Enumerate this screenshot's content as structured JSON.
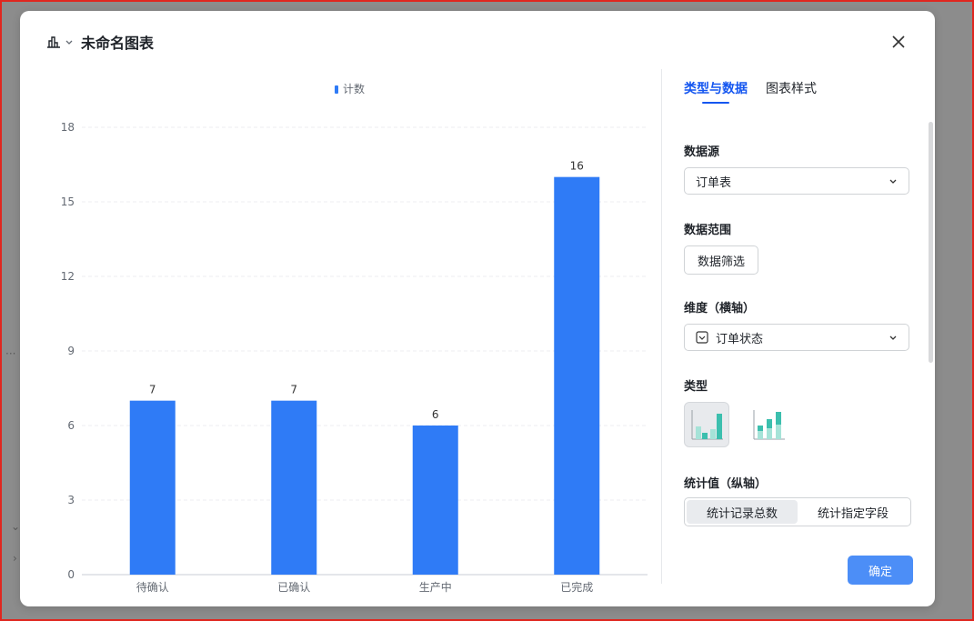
{
  "header": {
    "title": "未命名图表",
    "chart_type_icon": "bar-chart-icon",
    "close_icon": "close-icon"
  },
  "chart_data": {
    "type": "bar",
    "categories": [
      "待确认",
      "已确认",
      "生产中",
      "已完成"
    ],
    "series": [
      {
        "name": "计数",
        "values": [
          7,
          7,
          6,
          16
        ]
      }
    ],
    "ylim": [
      0,
      18
    ],
    "yticks": [
      0,
      3,
      6,
      9,
      12,
      15,
      18
    ],
    "grid": true,
    "legend": "top-center",
    "color": "#2f7bf6"
  },
  "panel": {
    "tabs": [
      {
        "label": "类型与数据",
        "active": true
      },
      {
        "label": "图表样式",
        "active": false
      }
    ],
    "datasource": {
      "label": "数据源",
      "value": "订单表"
    },
    "range": {
      "label": "数据范围",
      "button": "数据筛选"
    },
    "dimension": {
      "label": "维度（横轴）",
      "value": "订单状态",
      "icon": "single-select-field-icon"
    },
    "type": {
      "label": "类型",
      "options": [
        "grouped-bar-icon",
        "stacked-bar-icon"
      ]
    },
    "metric": {
      "label": "统计值（纵轴）",
      "options": [
        "统计记录总数",
        "统计指定字段"
      ],
      "selected": 0
    },
    "confirm": "确定"
  },
  "colors": {
    "accent": "#1456f0",
    "bar": "#2f7bf6",
    "confirm": "#4c8ef7"
  }
}
